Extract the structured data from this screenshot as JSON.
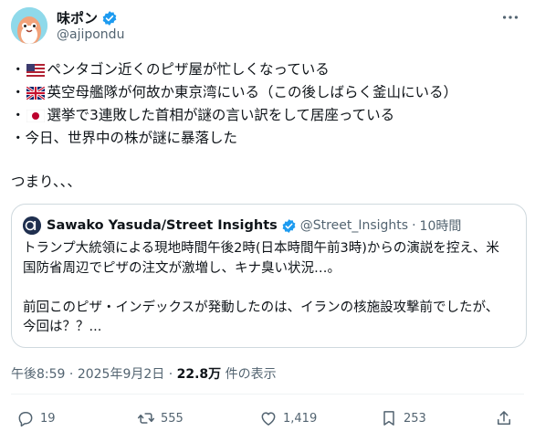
{
  "author": {
    "display_name": "味ポン",
    "handle": "@ajipondu",
    "verified": true
  },
  "post": {
    "lines": [
      {
        "bullet": "・",
        "flag": "us-flag",
        "text": "ペンタゴン近くのピザ屋が忙しくなっている"
      },
      {
        "bullet": "・",
        "flag": "uk-flag",
        "text": "英空母艦隊が何故か東京湾にいる（この後しばらく釜山にいる）"
      },
      {
        "bullet": "・",
        "flag": "jp-flag",
        "text": "選挙で3連敗した首相が謎の言い訳をして居座っている"
      },
      {
        "bullet": "・",
        "flag": "",
        "text": "今日、世界中の株が謎に暴落した"
      }
    ],
    "conclusion": "つまり、、、"
  },
  "quoted": {
    "display_name": "Sawako Yasuda/Street Insights",
    "handle": "@Street_Insights",
    "separator": "·",
    "time": "10時間",
    "paragraph1_line1": "トランプ大統領による現地時間午後2時(日本時間午前3時)からの演説を控え、米",
    "paragraph1_line2": "国防省周辺でピザの注文が激増し、キナ臭い状況…。",
    "paragraph2_line1": "前回このピザ・インデックスが発動したのは、イランの核施設攻撃前でしたが、",
    "paragraph2_line2": "今回は？？..."
  },
  "meta": {
    "time": "午後8:59",
    "sep1": "·",
    "date": "2025年9月2日",
    "sep2": "·",
    "views": "22.8万",
    "views_label": "件の表示"
  },
  "actions": {
    "replies": "19",
    "reposts": "555",
    "likes": "1,419",
    "bookmarks": "253"
  },
  "colors": {
    "verified": "#1d9bf0",
    "secondary_text": "#536471",
    "border": "#cfd9de"
  }
}
